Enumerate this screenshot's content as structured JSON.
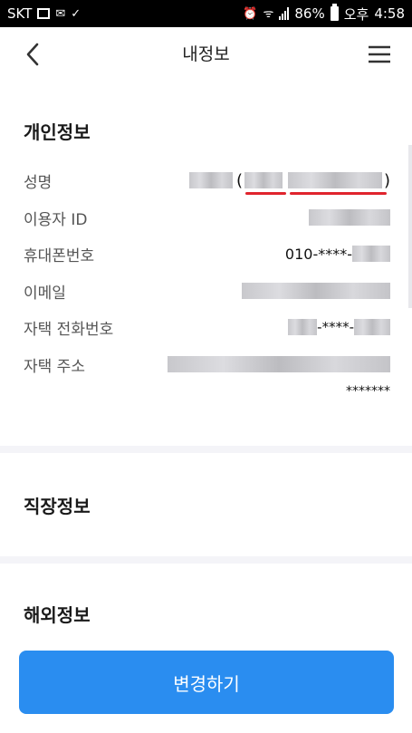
{
  "statusbar": {
    "carrier": "SKT",
    "battery": "86%",
    "ampm": "오후",
    "time": "4:58"
  },
  "header": {
    "title": "내정보",
    "back_icon": "chevron-left-icon",
    "menu_icon": "hamburger-menu-icon"
  },
  "personal": {
    "title": "개인정보",
    "rows": [
      {
        "label": "성명"
      },
      {
        "label": "이용자 ID"
      },
      {
        "label": "휴대폰번호",
        "value_prefix": "010-****-"
      },
      {
        "label": "이메일"
      },
      {
        "label": "자택 전화번호",
        "value_mid": "-****-"
      },
      {
        "label": "자택 주소",
        "value_suffix": "*******"
      }
    ]
  },
  "work": {
    "title": "직장정보"
  },
  "overseas": {
    "title": "해외정보"
  },
  "footer": {
    "button_label": "변경하기"
  },
  "colors": {
    "accent": "#2a8df0",
    "highlight": "#e0242d"
  }
}
